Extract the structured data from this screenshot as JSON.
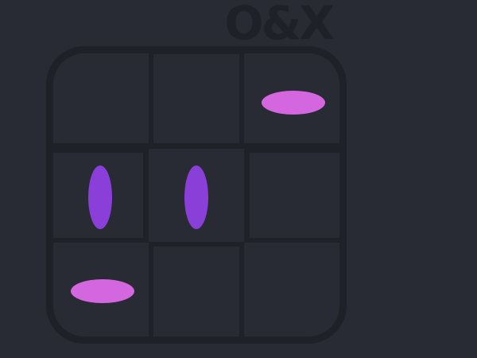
{
  "title": "O&X",
  "colors": {
    "background": "#282b33",
    "grid_line": "#1f2128",
    "mark_horizontal": "#d466e0",
    "mark_vertical": "#8b3fd9"
  },
  "board": {
    "rows": 3,
    "cols": 3,
    "cells": [
      [
        null,
        null,
        "horizontal-oval"
      ],
      [
        "vertical-oval",
        "vertical-oval",
        null
      ],
      [
        "horizontal-oval",
        null,
        null
      ]
    ]
  }
}
